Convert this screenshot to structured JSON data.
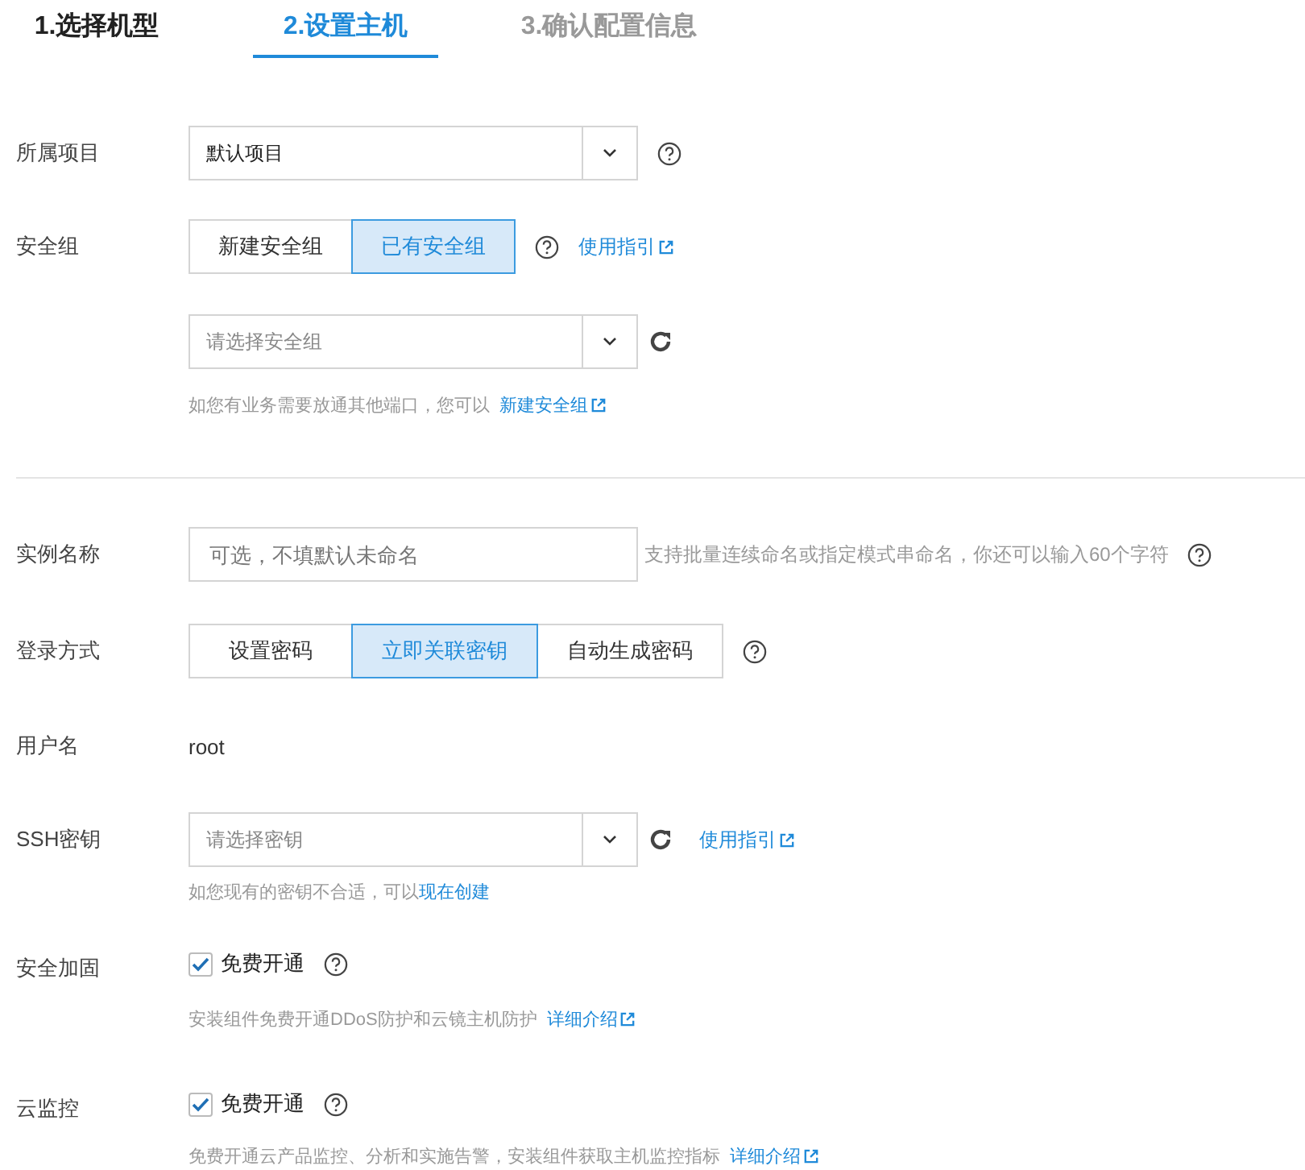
{
  "steps": [
    {
      "label": "1.选择机型",
      "selected": false,
      "done": true
    },
    {
      "label": "2.设置主机",
      "selected": true,
      "done": false
    },
    {
      "label": "3.确认配置信息",
      "selected": false,
      "done": false
    }
  ],
  "project": {
    "label": "所属项目",
    "value": "默认项目"
  },
  "security_group": {
    "label": "安全组",
    "options": [
      {
        "label": "新建安全组",
        "selected": false
      },
      {
        "label": "已有安全组",
        "selected": true
      }
    ],
    "guide_link": "使用指引",
    "placeholder": "请选择安全组",
    "hint": "如您有业务需要放通其他端口，您可以",
    "hint_link": "新建安全组"
  },
  "instance_name": {
    "label": "实例名称",
    "placeholder": "可选，不填默认未命名",
    "hint": "支持批量连续命名或指定模式串命名，你还可以输入60个字符"
  },
  "login": {
    "label": "登录方式",
    "options": [
      {
        "label": "设置密码",
        "selected": false
      },
      {
        "label": "立即关联密钥",
        "selected": true
      },
      {
        "label": "自动生成密码",
        "selected": false
      }
    ]
  },
  "username": {
    "label": "用户名",
    "value": "root"
  },
  "ssh_key": {
    "label": "SSH密钥",
    "placeholder": "请选择密钥",
    "guide_link": "使用指引",
    "hint": "如您现有的密钥不合适，可以",
    "hint_link": "现在创建"
  },
  "services": [
    {
      "label": "安全加固",
      "option": "免费开通",
      "checked": true,
      "hint": "安装组件免费开通DDoS防护和云镜主机防护",
      "link": "详细介绍"
    },
    {
      "label": "云监控",
      "option": "免费开通",
      "checked": true,
      "hint": "免费开通云产品监控、分析和实施告警，安装组件获取主机监控指标",
      "link": "详细介绍"
    }
  ]
}
